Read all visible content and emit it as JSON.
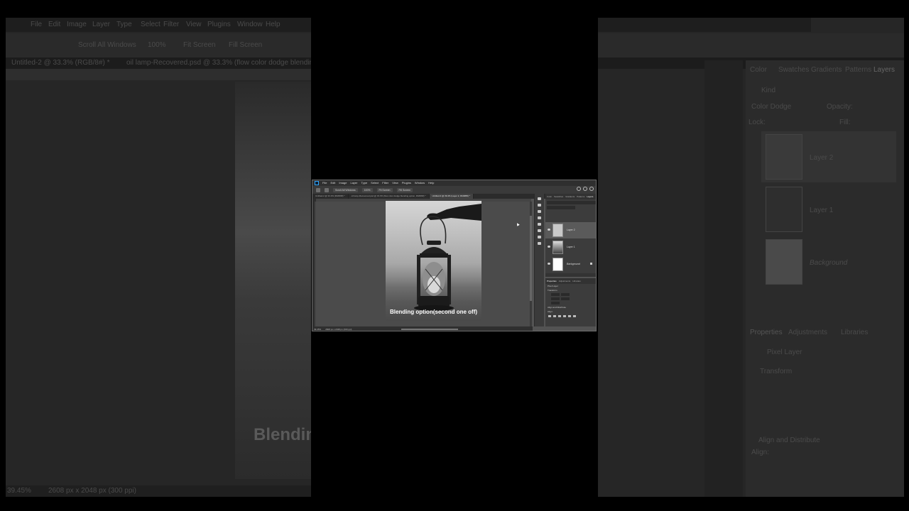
{
  "app": {
    "menu": [
      "File",
      "Edit",
      "Image",
      "Layer",
      "Type",
      "Select",
      "Filter",
      "View",
      "Plugins",
      "Window",
      "Help"
    ],
    "options": [
      "Scroll All Windows",
      "100%",
      "Fit Screen",
      "Fill Screen"
    ],
    "tabs": [
      {
        "label": "Untitled-2 @ 33.3% (RGB/8#) *",
        "active": false
      },
      {
        "label": "oil lamp-Recovered.psd @ 33.3% (flow color dodge blending option, RGB/8#) *",
        "active": false
      },
      {
        "label": "Untitled-3 @ 39.4% (Layer 2, RGB/8#) *",
        "active": true
      }
    ],
    "status": {
      "zoom": "39.45%",
      "size": "2608 px x 2048 px (300 ppi)"
    },
    "caption": "Blending option(second one off)",
    "background_caption": "Blendin"
  },
  "panels": {
    "top_tabs": [
      "Color",
      "Swatches",
      "Gradients",
      "Patterns",
      "Layers"
    ],
    "active_top_tab": "Layers",
    "search_placeholder": "Kind",
    "blend_mode": "Color Dodge",
    "opacity_label": "Opacity:",
    "lock_label": "Lock:",
    "fill_label": "Fill:",
    "layers": [
      {
        "name": "Layer 2",
        "selected": true,
        "italic": false
      },
      {
        "name": "Layer 1",
        "selected": false,
        "italic": false
      },
      {
        "name": "Background",
        "selected": false,
        "italic": true,
        "locked": true
      }
    ],
    "props_tabs": [
      "Properties",
      "Adjustments",
      "Libraries"
    ],
    "active_props_tab": "Properties",
    "props_kind": "Pixel Layer",
    "transform_label": "Transform",
    "align_label": "Align and Distribute",
    "align_sub": "Align:"
  },
  "colors": {
    "accent": "#31a8ff",
    "panel": "#3c3c3c",
    "workspace": "#4b4b4b"
  }
}
